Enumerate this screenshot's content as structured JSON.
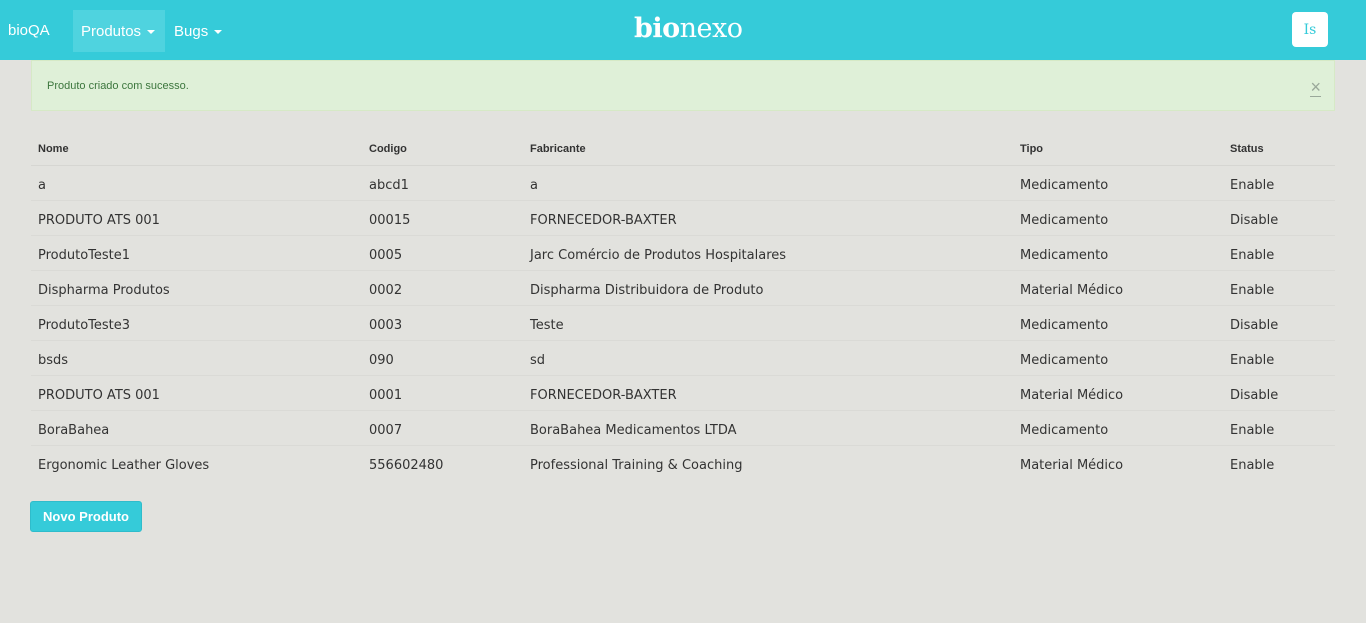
{
  "nav": {
    "brand": "bioQA",
    "produtos": "Produtos",
    "bugs": "Bugs",
    "logo_bold": "bio",
    "logo_light": "nexo",
    "user_initials": "Is"
  },
  "alert": {
    "message": "Produto criado com sucesso.",
    "close": "×"
  },
  "table": {
    "headers": [
      "Nome",
      "Codigo",
      "Fabricante",
      "Tipo",
      "Status"
    ],
    "rows": [
      [
        "a",
        "abcd1",
        "a",
        "Medicamento",
        "Enable"
      ],
      [
        "PRODUTO ATS 001",
        "00015",
        "FORNECEDOR-BAXTER",
        "Medicamento",
        "Disable"
      ],
      [
        "ProdutoTeste1",
        "0005",
        "Jarc Comércio de Produtos Hospitalares",
        "Medicamento",
        "Enable"
      ],
      [
        "Dispharma Produtos",
        "0002",
        "Dispharma Distribuidora de Produto",
        "Material Médico",
        "Enable"
      ],
      [
        "ProdutoTeste3",
        "0003",
        "Teste",
        "Medicamento",
        "Disable"
      ],
      [
        "bsds",
        "090",
        "sd",
        "Medicamento",
        "Enable"
      ],
      [
        "PRODUTO ATS 001",
        "0001",
        "FORNECEDOR-BAXTER",
        "Material Médico",
        "Disable"
      ],
      [
        "BoraBahea",
        "0007",
        "BoraBahea Medicamentos LTDA",
        "Medicamento",
        "Enable"
      ],
      [
        "Ergonomic Leather Gloves",
        "556602480",
        "Professional Training & Coaching",
        "Material Médico",
        "Enable"
      ]
    ]
  },
  "actions": {
    "novo_produto": "Novo Produto"
  },
  "colors": {
    "accent": "#35cbd9",
    "background": "#e2e2de",
    "alert_bg": "#dff0d8",
    "alert_text": "#3c763d"
  }
}
